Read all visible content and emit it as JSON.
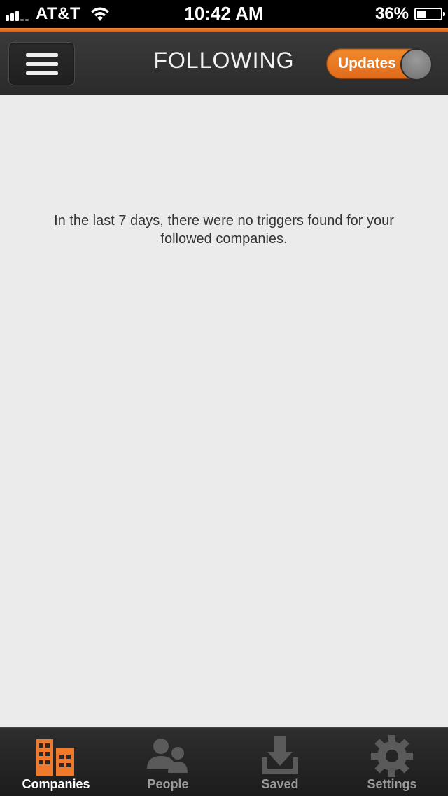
{
  "status_bar": {
    "carrier": "AT&T",
    "time": "10:42 AM",
    "battery_percent": "36%",
    "battery_level": 0.36
  },
  "nav": {
    "title": "FOLLOWING",
    "toggle_label": "Updates"
  },
  "content": {
    "empty_message": "In the last 7 days, there were no triggers found for your followed companies."
  },
  "tabs": [
    {
      "label": "Companies",
      "icon": "buildings-icon",
      "active": true
    },
    {
      "label": "People",
      "icon": "people-icon",
      "active": false
    },
    {
      "label": "Saved",
      "icon": "download-tray-icon",
      "active": false
    },
    {
      "label": "Settings",
      "icon": "gear-icon",
      "active": false
    }
  ],
  "colors": {
    "accent": "#f08a2c",
    "nav_bg": "#2f2f2f",
    "content_bg": "#ebebeb",
    "tab_inactive": "#9a9a9a",
    "tab_active_icon": "#f07a2c"
  }
}
